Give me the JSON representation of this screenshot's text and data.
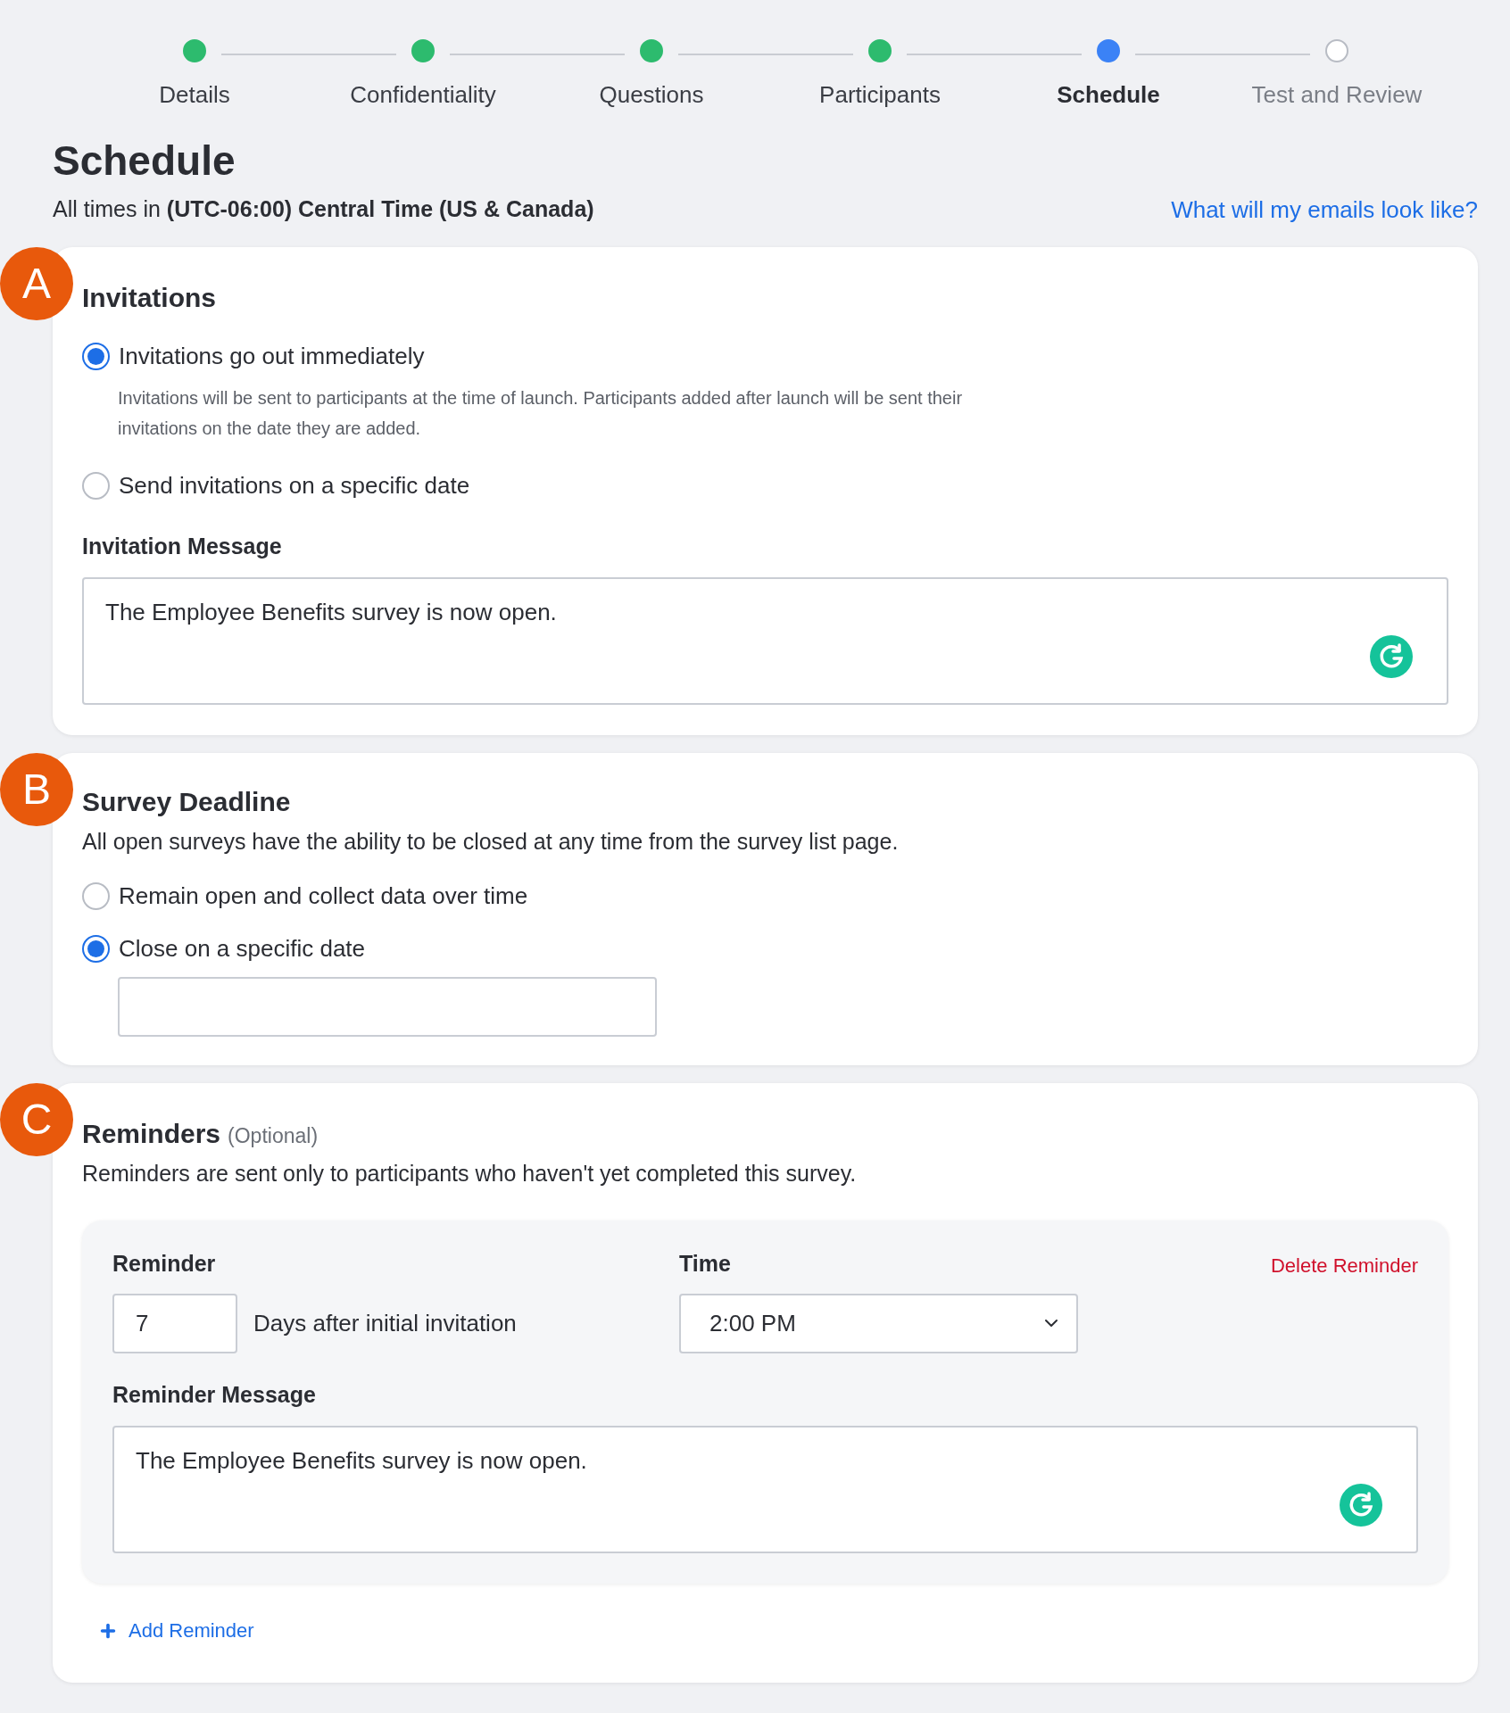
{
  "steps": [
    {
      "label": "Details",
      "completed": true,
      "selected": false
    },
    {
      "label": "Confidentiality",
      "completed": true,
      "selected": false
    },
    {
      "label": "Questions",
      "completed": true,
      "selected": false
    },
    {
      "label": "Participants",
      "completed": true,
      "selected": false
    },
    {
      "label": "Schedule",
      "completed": false,
      "selected": true
    },
    {
      "label": "Test and Review",
      "completed": false,
      "selected": false
    }
  ],
  "page": {
    "title": "Schedule",
    "timezone_note": "All times in **(UTC-06:00) Central Time (US & Canada)**",
    "email_preview_link": "What will my emails look like?"
  },
  "invitations": {
    "badge": "A",
    "title": "Invitations",
    "options": [
      {
        "label": "Invitations go out immediately",
        "selected": true,
        "help": "Invitations will be sent to participants at the time of launch. Participants added after launch will be sent their invitations on the date they are added."
      },
      {
        "label": "Send invitations on a specific date",
        "selected": false
      }
    ],
    "message_label": "Invitation Message",
    "message": "The Employee Benefits survey is now open."
  },
  "deadline": {
    "badge": "B",
    "title": "Survey Deadline",
    "description": "All open surveys have the ability to be closed at any time from the survey list page.",
    "options": [
      {
        "label": "Remain open and collect data over time",
        "selected": false
      },
      {
        "label": "Close on a specific date",
        "selected": true
      }
    ]
  },
  "reminders": {
    "badge": "C",
    "title": "Reminders",
    "optional": "(Optional)",
    "description": "Reminders are sent only to participants who haven't yet completed this survey.",
    "reminder_label": "Reminder",
    "days": "7",
    "days_suffix": "Days after initial invitation",
    "time_label": "Time",
    "time": "2:00 PM",
    "delete_link": "Delete Reminder",
    "message_label": "Reminder Message",
    "message": "The Employee Benefits survey is now open.",
    "add_link": "Add Reminder"
  }
}
